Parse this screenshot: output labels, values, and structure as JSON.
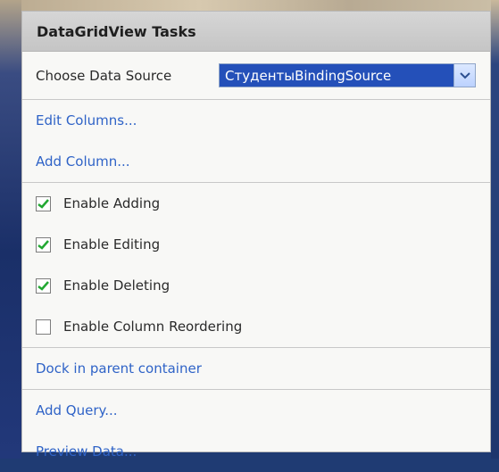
{
  "panel": {
    "title": "DataGridView Tasks",
    "choose_source_label": "Choose Data Source",
    "choose_source_value": "СтудентыBindingSource"
  },
  "links": [
    {
      "label": "Edit Columns..."
    },
    {
      "label": "Add Column..."
    },
    {
      "label": "Dock in parent container"
    },
    {
      "label": "Add Query..."
    },
    {
      "label": "Preview Data..."
    }
  ],
  "options": [
    {
      "label": "Enable Adding",
      "checked": true
    },
    {
      "label": "Enable Editing",
      "checked": true
    },
    {
      "label": "Enable Deleting",
      "checked": true
    },
    {
      "label": "Enable Column Reordering",
      "checked": false
    }
  ],
  "colors": {
    "accent": "#2450b9",
    "link": "#2f63c7",
    "panel_background": "#f8f8f6"
  },
  "icons": {
    "dropdown": "chevron-down-icon",
    "checked": "checkmark-icon"
  }
}
